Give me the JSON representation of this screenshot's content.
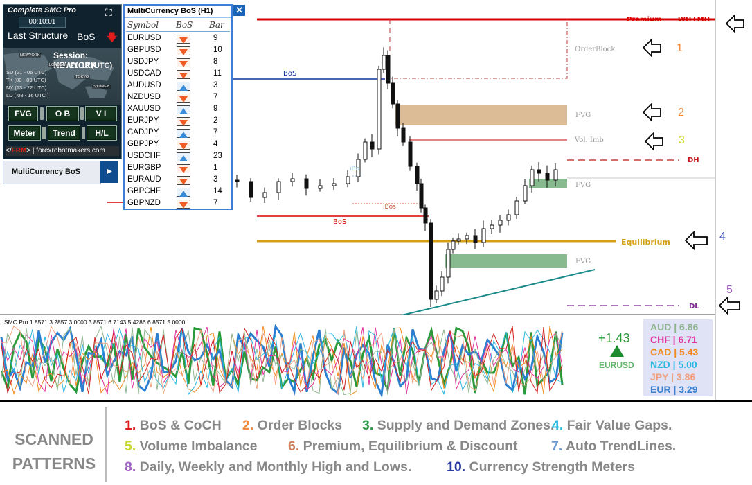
{
  "colors": {
    "bear": "#e01c1c",
    "bull_up_icon": "#3a8bd8",
    "bear_icon": "#f05a24",
    "premium": "#d60000",
    "equilibrium": "#d4a017",
    "discount_dl": "#7a2a8a",
    "fvg_green": "#7ab383",
    "fvg_tan": "#d6b084",
    "trendline": "#1b8a8a"
  },
  "smc_panel": {
    "title": "Complete SMC Pro",
    "clock": "00:10:01",
    "last_structure_label": "Last Structure",
    "structure_value": "BoS",
    "direction_icon": "arrow-down-icon",
    "session_label": "Session: NEWYORK",
    "utc_time": "21:10 (UTC)",
    "cities": [
      "NEWYORK",
      "LONDON",
      "TOKYO",
      "SYDNEY"
    ],
    "sessions": [
      "SD (21 - 06 UTC)",
      "TK (00 - 09 UTC)",
      "NY (13 - 22 UTC)",
      "LD ( 08 - 16 UTC )"
    ],
    "buttons": [
      "FVG",
      "O B",
      "V I",
      "Meter",
      "Trend",
      "H/L"
    ],
    "site_prefix": "</",
    "site_code": "FRM",
    "site_suffix": ">",
    "site_url": "forexrobotmakers.com"
  },
  "mc_tab": {
    "label": "MultiCurrency BoS"
  },
  "mc_table": {
    "title": "MultiCurrency BoS (H1)",
    "headers": [
      "Symbol",
      "BoS",
      "Bar"
    ],
    "rows": [
      {
        "symbol": "EURUSD",
        "dir": "down",
        "bar": "9"
      },
      {
        "symbol": "GBPUSD",
        "dir": "down",
        "bar": "10"
      },
      {
        "symbol": "USDJPY",
        "dir": "down",
        "bar": "8"
      },
      {
        "symbol": "USDCAD",
        "dir": "down",
        "bar": "11"
      },
      {
        "symbol": "AUDUSD",
        "dir": "up",
        "bar": "3"
      },
      {
        "symbol": "NZDUSD",
        "dir": "down",
        "bar": "7"
      },
      {
        "symbol": "XAUUSD",
        "dir": "up",
        "bar": "9"
      },
      {
        "symbol": "EURJPY",
        "dir": "down",
        "bar": "2"
      },
      {
        "symbol": "CADJPY",
        "dir": "up",
        "bar": "7"
      },
      {
        "symbol": "GBPJPY",
        "dir": "down",
        "bar": "4"
      },
      {
        "symbol": "USDCHF",
        "dir": "up",
        "bar": "23"
      },
      {
        "symbol": "EURGBP",
        "dir": "down",
        "bar": "1"
      },
      {
        "symbol": "EURAUD",
        "dir": "down",
        "bar": "3"
      },
      {
        "symbol": "GBPCHF",
        "dir": "up",
        "bar": "14"
      },
      {
        "symbol": "GBPNZD",
        "dir": "down",
        "bar": "7"
      }
    ]
  },
  "chart_labels": {
    "premium": "Premium",
    "wh_mh": "WH+MH",
    "orderblock": "OrderBlock",
    "fvg": "FVG",
    "vol_imb": "Vol. Imb",
    "dh": "DH",
    "equilibrium": "Equilibrium",
    "dl": "DL",
    "bos": "BoS",
    "ibos": "iBos",
    "ibo": "iBo"
  },
  "markers": [
    "1",
    "2",
    "3",
    "4",
    "5"
  ],
  "oscillator": {
    "label": "SMC Pro 1.8571 3.2857 3.0000 3.8571 6.7143 5.4286 6.8571 5.0000"
  },
  "ticker": {
    "change": "+1.43",
    "symbol": "EURUSD"
  },
  "strength": [
    {
      "text": "AUD | 6.86",
      "color": "#8fb58f"
    },
    {
      "text": "CHF | 6.71",
      "color": "#e0309a"
    },
    {
      "text": "CAD | 5.43",
      "color": "#f08a1e"
    },
    {
      "text": "NZD | 5.00",
      "color": "#2bb7e0"
    },
    {
      "text": "JPY | 3.86",
      "color": "#f0a080"
    },
    {
      "text": "EUR | 3.29",
      "color": "#3a7fd0"
    }
  ],
  "banner": {
    "title_line1": "SCANNED",
    "title_line2": "PATTERNS",
    "patterns": [
      {
        "n": "1.",
        "text": " BoS & CoCH",
        "color": "#e01c1c"
      },
      {
        "n": "2.",
        "text": " Order Blocks",
        "color": "#f08a3c"
      },
      {
        "n": "3.",
        "text": " Supply and Demand Zones.",
        "color": "#2a9a4a"
      },
      {
        "n": "4.",
        "text": " Fair Value Gaps.",
        "color": "#2bb7e0"
      },
      {
        "n": "5.",
        "text": " Volume Imbalance",
        "color": "#c8d82a"
      },
      {
        "n": "6.",
        "text": " Premium, Equilibrium & Discount",
        "color": "#d08060"
      },
      {
        "n": "7.",
        "text": " Auto TrendLines.",
        "color": "#6a9ad0"
      },
      {
        "n": "8.",
        "text": " Daily, Weekly and Monthly High and Lows.",
        "color": "#a060c0"
      },
      {
        "n": "10.",
        "text": " Currency Strength Meters",
        "color": "#2a3aa0"
      }
    ]
  }
}
